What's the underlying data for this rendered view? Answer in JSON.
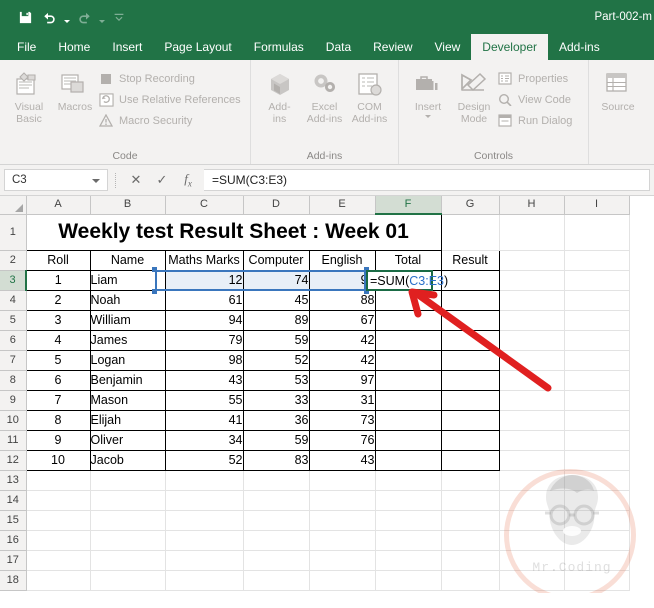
{
  "window": {
    "document_title": "Part-002-m",
    "quick_access": [
      {
        "name": "save",
        "label": "Save"
      },
      {
        "name": "undo",
        "label": "Undo"
      },
      {
        "name": "redo",
        "label": "Redo"
      },
      {
        "name": "customize-qat",
        "label": "Customize Quick Access Toolbar"
      }
    ]
  },
  "ribbon": {
    "tabs": [
      {
        "label": "File",
        "active": false
      },
      {
        "label": "Home",
        "active": false
      },
      {
        "label": "Insert",
        "active": false
      },
      {
        "label": "Page Layout",
        "active": false
      },
      {
        "label": "Formulas",
        "active": false
      },
      {
        "label": "Data",
        "active": false
      },
      {
        "label": "Review",
        "active": false
      },
      {
        "label": "View",
        "active": false
      },
      {
        "label": "Developer",
        "active": true
      },
      {
        "label": "Add-ins",
        "active": false
      }
    ],
    "groups": [
      {
        "title": "Code",
        "big_buttons": [
          {
            "label_line1": "Visual",
            "label_line2": "Basic",
            "icon": "visual-basic-icon"
          },
          {
            "label_line1": "Macros",
            "label_line2": "",
            "icon": "macros-icon"
          }
        ],
        "small_buttons": [
          {
            "label": "Stop Recording",
            "icon": "stop-recording-icon"
          },
          {
            "label": "Use Relative References",
            "icon": "relative-references-icon"
          },
          {
            "label": "Macro Security",
            "icon": "macro-security-icon"
          }
        ]
      },
      {
        "title": "Add-ins",
        "big_buttons": [
          {
            "label_line1": "Add-",
            "label_line2": "ins",
            "icon": "add-ins-icon"
          },
          {
            "label_line1": "Excel",
            "label_line2": "Add-ins",
            "icon": "excel-add-ins-icon"
          },
          {
            "label_line1": "COM",
            "label_line2": "Add-ins",
            "icon": "com-add-ins-icon"
          }
        ],
        "small_buttons": []
      },
      {
        "title": "Controls",
        "big_buttons": [
          {
            "label_line1": "Insert",
            "label_line2": "",
            "icon": "insert-control-icon",
            "has_dropdown": true
          },
          {
            "label_line1": "Design",
            "label_line2": "Mode",
            "icon": "design-mode-icon"
          }
        ],
        "small_buttons": [
          {
            "label": "Properties",
            "icon": "properties-icon"
          },
          {
            "label": "View Code",
            "icon": "view-code-icon"
          },
          {
            "label": "Run Dialog",
            "icon": "run-dialog-icon"
          }
        ]
      },
      {
        "title": "",
        "big_buttons": [
          {
            "label_line1": "Source",
            "label_line2": "",
            "icon": "xml-source-icon"
          }
        ],
        "small_buttons": []
      }
    ]
  },
  "formula_bar": {
    "name_box_value": "C3",
    "cancel_label": "✕",
    "enter_label": "✓",
    "function_label": "fx",
    "formula_value": "=SUM(C3:E3)"
  },
  "grid": {
    "column_headers": [
      "A",
      "B",
      "C",
      "D",
      "E",
      "F",
      "G",
      "H",
      "I"
    ],
    "selected_column": "F",
    "selected_row": "3",
    "row_headers": [
      "1",
      "2",
      "3",
      "4",
      "5",
      "6",
      "7",
      "8",
      "9",
      "10",
      "11",
      "12",
      "13",
      "14",
      "15",
      "16",
      "17",
      "18"
    ],
    "sheet_title": "Weekly test Result Sheet : Week 01",
    "table_headers": [
      "Roll",
      "Name",
      "Maths Marks",
      "Computer",
      "English",
      "Total",
      "Result"
    ],
    "rows": [
      {
        "roll": "1",
        "name": "Liam",
        "maths": "12",
        "computer": "74",
        "english": "98",
        "total": "",
        "result": ""
      },
      {
        "roll": "2",
        "name": "Noah",
        "maths": "61",
        "computer": "45",
        "english": "88",
        "total": "",
        "result": ""
      },
      {
        "roll": "3",
        "name": "William",
        "maths": "94",
        "computer": "89",
        "english": "67",
        "total": "",
        "result": ""
      },
      {
        "roll": "4",
        "name": "James",
        "maths": "79",
        "computer": "59",
        "english": "42",
        "total": "",
        "result": ""
      },
      {
        "roll": "5",
        "name": "Logan",
        "maths": "98",
        "computer": "52",
        "english": "42",
        "total": "",
        "result": ""
      },
      {
        "roll": "6",
        "name": "Benjamin",
        "maths": "43",
        "computer": "53",
        "english": "97",
        "total": "",
        "result": ""
      },
      {
        "roll": "7",
        "name": "Mason",
        "maths": "55",
        "computer": "33",
        "english": "31",
        "total": "",
        "result": ""
      },
      {
        "roll": "8",
        "name": "Elijah",
        "maths": "41",
        "computer": "36",
        "english": "73",
        "total": "",
        "result": ""
      },
      {
        "roll": "9",
        "name": "Oliver",
        "maths": "34",
        "computer": "59",
        "english": "76",
        "total": "",
        "result": ""
      },
      {
        "roll": "10",
        "name": "Jacob",
        "maths": "52",
        "computer": "83",
        "english": "43",
        "total": "",
        "result": ""
      }
    ],
    "active_cell": {
      "reference": "F3",
      "prefix_text": "=SUM(",
      "range_text": "C3:E3",
      "suffix_text": ")"
    },
    "selection_range": "C3:E3"
  },
  "annotation": {
    "arrow_color": "#e02020",
    "points_to": "F3"
  },
  "watermark": {
    "text": "Mr.Coding"
  },
  "colors": {
    "excel_green": "#217346",
    "active_cell_border": "#1a6b45",
    "marquee_blue": "#3a76bd",
    "formula_ref_blue": "#2a6fc9"
  }
}
